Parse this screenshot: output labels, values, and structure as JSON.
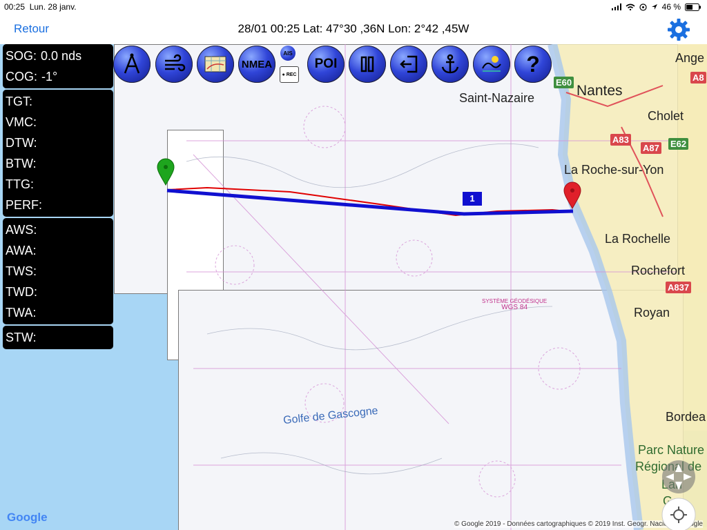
{
  "status_bar": {
    "time": "00:25",
    "date": "Lun. 28 janv.",
    "battery": "46 %"
  },
  "nav_bar": {
    "back_label": "Retour",
    "title": "28/01 00:25  Lat: 47°30 ,36N Lon: 2°42 ,45W"
  },
  "instruments": {
    "group1": [
      {
        "label": "SOG",
        "value": "0.0 nds"
      },
      {
        "label": "COG",
        "value": "-1°"
      }
    ],
    "group2": [
      {
        "label": "TGT",
        "value": ""
      },
      {
        "label": "VMC",
        "value": ""
      },
      {
        "label": "DTW",
        "value": ""
      },
      {
        "label": "BTW",
        "value": ""
      },
      {
        "label": "TTG",
        "value": ""
      },
      {
        "label": "PERF",
        "value": ""
      }
    ],
    "group3": [
      {
        "label": "AWS",
        "value": ""
      },
      {
        "label": "AWA",
        "value": ""
      },
      {
        "label": "TWS",
        "value": ""
      },
      {
        "label": "TWD",
        "value": ""
      },
      {
        "label": "TWA",
        "value": ""
      }
    ],
    "group4": [
      {
        "label": "STW",
        "value": ""
      }
    ]
  },
  "toolbar": {
    "nmea_label": "NMEA",
    "ais_label": "AIS",
    "rec_label": "● REC",
    "poi_label": "POI",
    "help_label": "?"
  },
  "map": {
    "cities": {
      "saint_nazaire": "Saint-Nazaire",
      "nantes": "Nantes",
      "angers": "Ange",
      "cholet": "Cholet",
      "la_roche": "La Roche-sur-Yon",
      "la_rochelle": "La Rochelle",
      "rochefort": "Rochefort",
      "royan": "Royan",
      "bordeaux": "Bordea",
      "parc1": "Parc Nature",
      "parc2": "Régional de",
      "parc3": "Lan",
      "parc4": "Ga"
    },
    "roads": {
      "e60": "E60",
      "a83": "A83",
      "a87": "A87",
      "e62": "E62",
      "a837": "A837",
      "a8": "A8"
    },
    "sea_label": "Golfe de Gascogne",
    "wgs_line1": "SYSTÈME GÉODÉSIQUE",
    "wgs_line2": "WGS 84",
    "waypoint_number": "1",
    "google_logo": "Google",
    "credits": "© Google 2019 - Données cartographiques © 2019 Inst. Geogr. Nacional, Google",
    "route_color": "#1010d0",
    "track_color": "#e00000",
    "start_marker_color": "#1ea51e",
    "end_marker_color": "#e0202a"
  }
}
